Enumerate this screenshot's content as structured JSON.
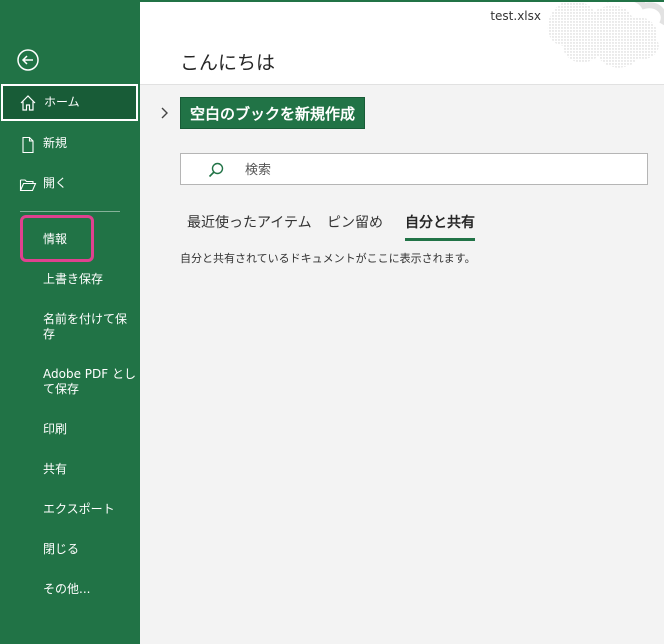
{
  "window": {
    "filename": "test.xlsx"
  },
  "main": {
    "greeting": "こんにちは",
    "new_workbook_label": "空白のブックを新規作成",
    "search_placeholder": "検索",
    "tabs": [
      {
        "label": "最近使ったアイテム",
        "active": false
      },
      {
        "label": "ピン留め",
        "active": false
      },
      {
        "label": "自分と共有",
        "active": true
      }
    ],
    "empty_message": "自分と共有されているドキュメントがここに表示されます。"
  },
  "sidebar": {
    "back_icon": "back-arrow-icon",
    "items": [
      {
        "label": "ホーム",
        "icon": "home-icon"
      },
      {
        "label": "新規",
        "icon": "new-document-icon"
      },
      {
        "label": "開く",
        "icon": "open-folder-icon"
      },
      {
        "label": "情報"
      },
      {
        "label": "上書き保存"
      },
      {
        "label": "名前を付けて保存"
      },
      {
        "label": "Adobe PDF として保存"
      },
      {
        "label": "印刷"
      },
      {
        "label": "共有"
      },
      {
        "label": "エクスポート"
      },
      {
        "label": "閉じる"
      },
      {
        "label": "その他..."
      }
    ]
  },
  "colors": {
    "sidebar_bg": "#217346",
    "sidebar_active_bg": "#185c37",
    "accent": "#217346",
    "highlight": "#e0418f",
    "page_bg": "#f3f3f3"
  }
}
